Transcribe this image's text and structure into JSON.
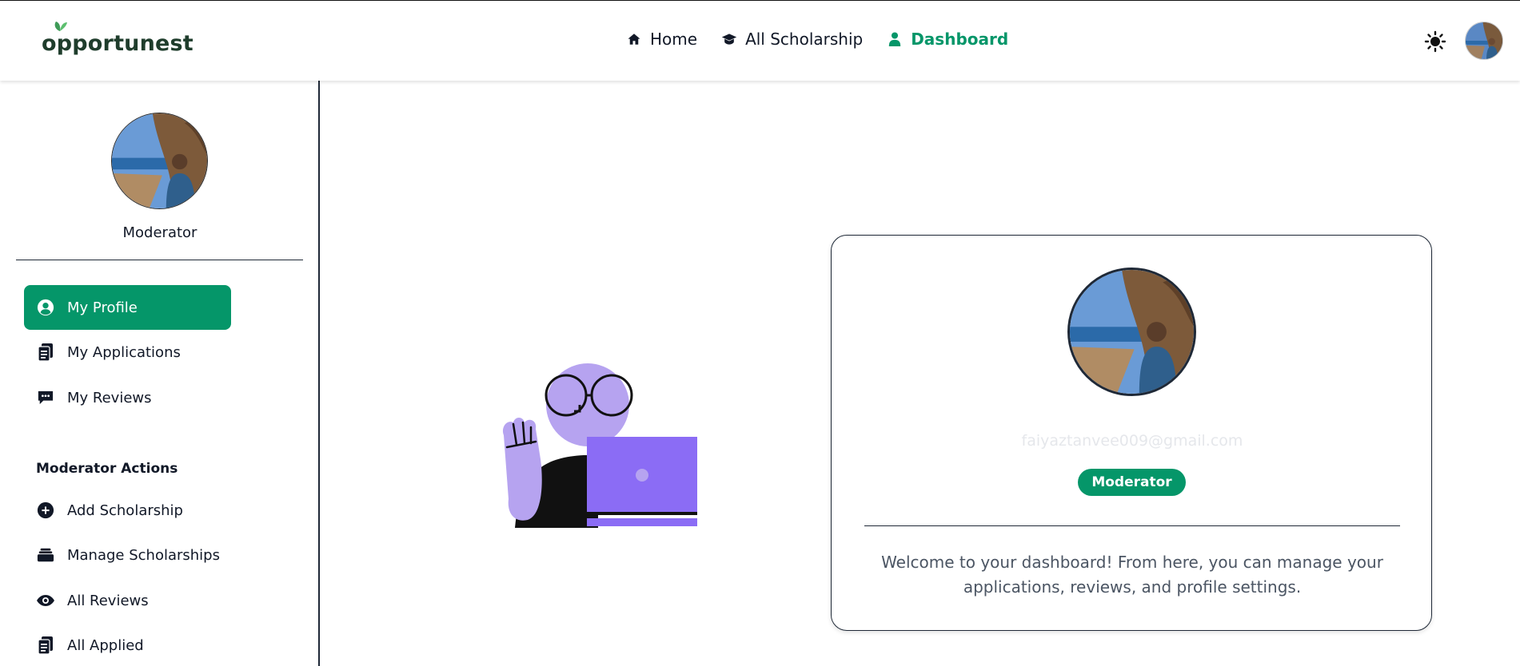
{
  "brand": {
    "name": "opportunest",
    "accent": "#059669"
  },
  "navbar": {
    "links": [
      {
        "label": "Home",
        "icon": "home-icon"
      },
      {
        "label": "All Scholarship",
        "icon": "graduation-cap-icon"
      },
      {
        "label": "Dashboard",
        "icon": "user-icon",
        "active": true
      }
    ],
    "theme_icon": "sun-icon"
  },
  "sidebar": {
    "role": "Moderator",
    "items": [
      {
        "label": "My Profile",
        "icon": "user-circle-icon",
        "active": true
      },
      {
        "label": "My Applications",
        "icon": "clipboard-icon"
      },
      {
        "label": "My Reviews",
        "icon": "comment-icon"
      }
    ],
    "section_title": "Moderator Actions",
    "moderator_items": [
      {
        "label": "Add Scholarship",
        "icon": "plus-circle-icon"
      },
      {
        "label": "Manage Scholarships",
        "icon": "layers-icon"
      },
      {
        "label": "All Reviews",
        "icon": "eye-icon"
      },
      {
        "label": "All Applied",
        "icon": "clipboard-icon"
      }
    ]
  },
  "profile_card": {
    "email": "faiyaztanvee009@gmail.com",
    "badge": "Moderator",
    "welcome": "Welcome to your dashboard! From here, you can manage your applications, reviews, and profile settings."
  }
}
